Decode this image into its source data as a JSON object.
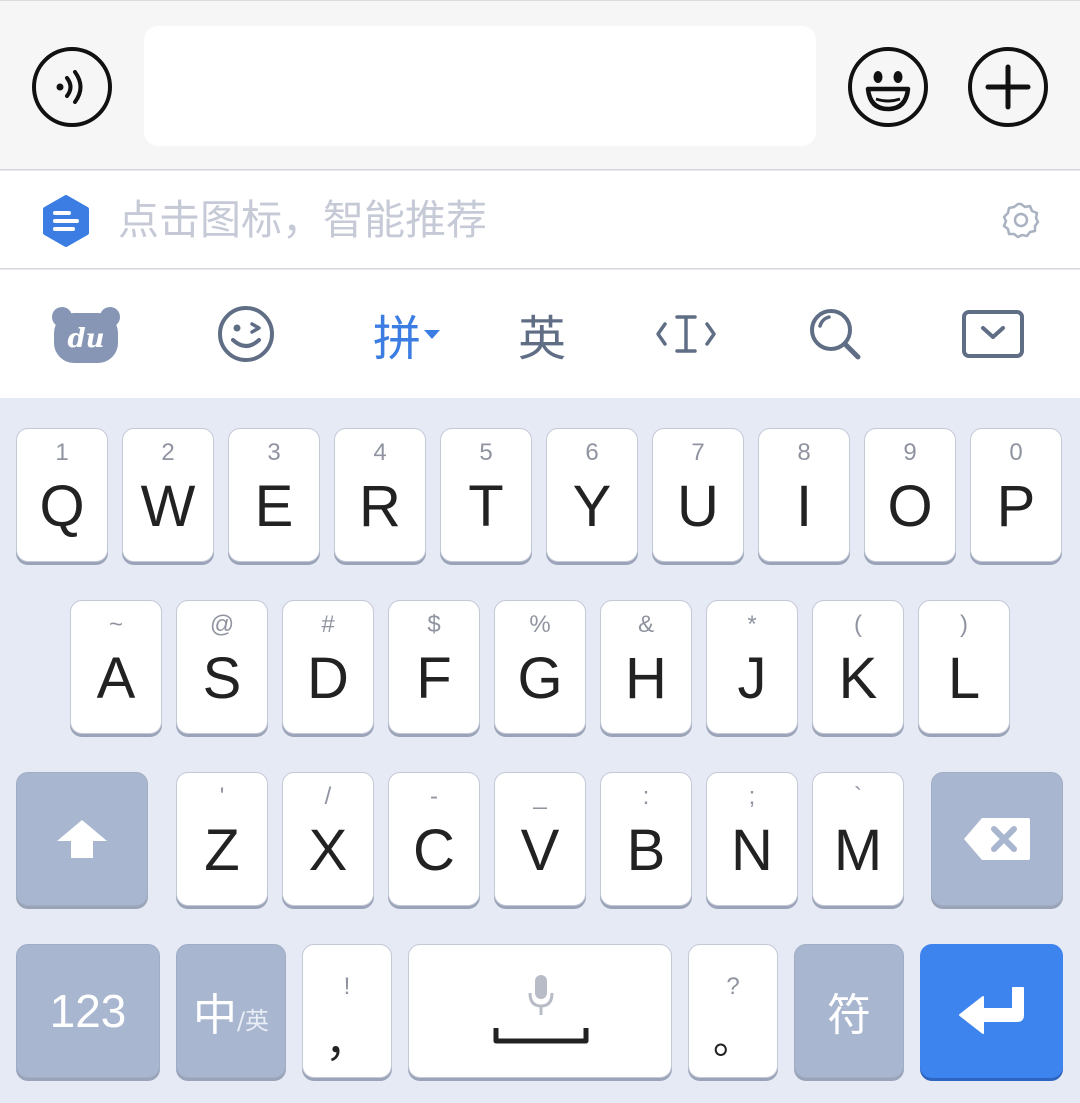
{
  "chat": {
    "voice_icon": "voice-icon",
    "input_value": "",
    "emoji_icon": "smiley-icon",
    "plus_icon": "plus-icon"
  },
  "suggestion": {
    "hint": "点击图标，智能推荐",
    "brand_icon": "baidu-hex-icon",
    "settings_icon": "gear-icon",
    "accent": "#3b7de3"
  },
  "toolbar": {
    "du_label": "du",
    "pinyin_label": "拼",
    "english_label": "英"
  },
  "keyboard": {
    "row1": [
      {
        "sub": "1",
        "main": "Q"
      },
      {
        "sub": "2",
        "main": "W"
      },
      {
        "sub": "3",
        "main": "E"
      },
      {
        "sub": "4",
        "main": "R"
      },
      {
        "sub": "5",
        "main": "T"
      },
      {
        "sub": "6",
        "main": "Y"
      },
      {
        "sub": "7",
        "main": "U"
      },
      {
        "sub": "8",
        "main": "I"
      },
      {
        "sub": "9",
        "main": "O"
      },
      {
        "sub": "0",
        "main": "P"
      }
    ],
    "row2": [
      {
        "sub": "~",
        "main": "A"
      },
      {
        "sub": "@",
        "main": "S"
      },
      {
        "sub": "#",
        "main": "D"
      },
      {
        "sub": "$",
        "main": "F"
      },
      {
        "sub": "%",
        "main": "G"
      },
      {
        "sub": "&",
        "main": "H"
      },
      {
        "sub": "*",
        "main": "J"
      },
      {
        "sub": "(",
        "main": "K"
      },
      {
        "sub": ")",
        "main": "L"
      }
    ],
    "row3": [
      {
        "sub": "'",
        "main": "Z"
      },
      {
        "sub": "/",
        "main": "X"
      },
      {
        "sub": "-",
        "main": "C"
      },
      {
        "sub": "_",
        "main": "V"
      },
      {
        "sub": ":",
        "main": "B"
      },
      {
        "sub": ";",
        "main": "N"
      },
      {
        "sub": "`",
        "main": "M"
      }
    ],
    "num_label": "123",
    "zh_label": "中",
    "zh_sub_label": "/英",
    "comma_sub": "!",
    "comma_main": "，",
    "period_sub": "?",
    "period_main": "。",
    "symbol_label": "符",
    "colors": {
      "key_bg": "#ffffff",
      "function_key_bg": "#a8b6cf",
      "enter_bg": "#3d84ee",
      "keyboard_bg": "#e6eaf4"
    }
  }
}
